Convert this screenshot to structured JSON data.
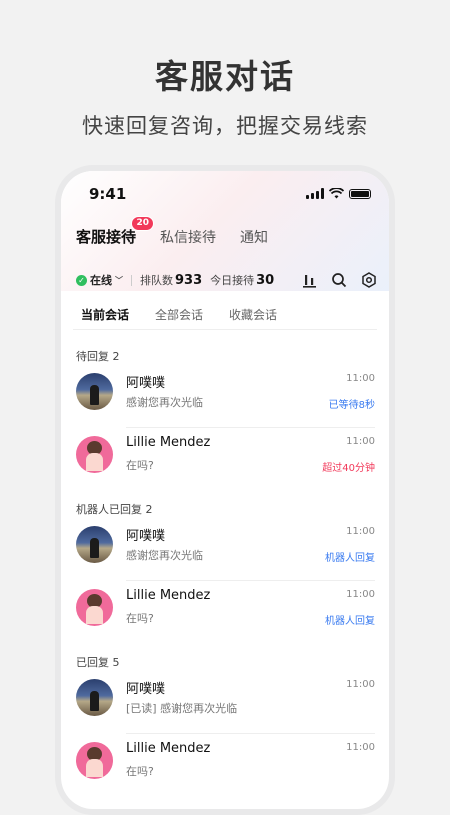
{
  "hero": {
    "title": "客服对话",
    "subtitle": "快速回复咨询，把握交易线索"
  },
  "status_bar": {
    "time": "9:41"
  },
  "tabs": [
    {
      "label": "客服接待",
      "badge": "20",
      "active": true
    },
    {
      "label": "私信接待"
    },
    {
      "label": "通知"
    }
  ],
  "toolbar": {
    "status_label": "在线",
    "queue_label": "排队数",
    "queue_count": "933",
    "today_label": "今日接待",
    "today_count": "30"
  },
  "subtabs": [
    {
      "label": "当前会话",
      "active": true
    },
    {
      "label": "全部会话"
    },
    {
      "label": "收藏会话"
    }
  ],
  "sections": [
    {
      "title": "待回复 2",
      "items": [
        {
          "name": "阿噗噗",
          "message": "感谢您再次光临",
          "time": "11:00",
          "tag": "已等待8秒",
          "tag_color": "#3a7bf0"
        },
        {
          "name": "Lillie Mendez",
          "message": "在吗?",
          "time": "11:00",
          "tag": "超过40分钟",
          "tag_color": "#f2395a"
        }
      ]
    },
    {
      "title": "机器人已回复 2",
      "items": [
        {
          "name": "阿噗噗",
          "message": "感谢您再次光临",
          "time": "11:00",
          "tag": "机器人回复",
          "tag_color": "#3a7bf0"
        },
        {
          "name": "Lillie Mendez",
          "message": "在吗?",
          "time": "11:00",
          "tag": "机器人回复",
          "tag_color": "#3a7bf0"
        }
      ]
    },
    {
      "title": "已回复 5",
      "items": [
        {
          "name": "阿噗噗",
          "message": "[已读] 感谢您再次光临",
          "time": "11:00"
        },
        {
          "name": "Lillie Mendez",
          "message": "在吗?",
          "time": "11:00"
        }
      ]
    }
  ]
}
